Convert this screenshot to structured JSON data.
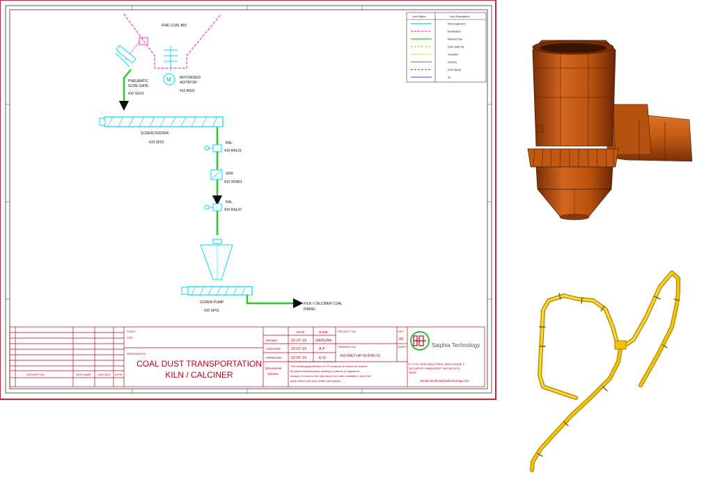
{
  "drawing": {
    "labels": {
      "fine_coal_bin": "FINE COAL BIN",
      "pneumatic_slide_gate": [
        "PNEUMATIC",
        "SLIDE GATE",
        "410 SG01"
      ],
      "motorised_agitator": [
        "MOTORISED",
        "AGITATOR",
        "410 AG01"
      ],
      "screw_feeder": [
        "SCREW FEEDER",
        "410 SF01"
      ],
      "ral_1": [
        "RAL",
        "410 RAL01"
      ],
      "sfm": [
        "SFM",
        "410 SFM01"
      ],
      "ral_2": [
        "RAL",
        "410 RAL02"
      ],
      "screw_pump": [
        "SCREW PUMP",
        "410 SP01"
      ],
      "kiln_firing": [
        "KILN / CALCINER COAL",
        "FIRING"
      ]
    },
    "legend": {
      "header_style": "Line Styles",
      "header_desc": "Line Description",
      "rows": [
        {
          "description": "New Equipment",
          "color": "#00d8ff",
          "dash": "solid"
        },
        {
          "description": "Modification",
          "color": "#ff33cc",
          "dash": "dashed"
        },
        {
          "description": "Material Flow",
          "color": "#22cc22",
          "dash": "solid"
        },
        {
          "description": "Dust Laden Air",
          "color": "#99cc66",
          "dash": "dashed"
        },
        {
          "description": "Insulation",
          "color": "#f0e060",
          "dash": "solid"
        },
        {
          "description": "Existing",
          "color": "#888888",
          "dash": "solid"
        },
        {
          "description": "Duct Taping",
          "color": "#666666",
          "dash": "dashed"
        },
        {
          "description": "Air",
          "color": "#6666ff",
          "dash": "solid"
        }
      ]
    },
    "title_block": {
      "revision_headers": [
        "DESCRIPTION",
        "DATE/NAME",
        "CHECKED",
        "APPR."
      ],
      "plant_label": "PLANT",
      "site_label": "SITE",
      "designation_label": "DESIGNATION",
      "title_line1": "COAL DUST TRANSPORTATION",
      "title_line2": "KILN / CALCINER",
      "date_header": "DATE",
      "name_header": "NAME",
      "drawn_label": "DRAWN",
      "drawn_date": "22-07-19",
      "drawn_name": "SANGAR",
      "checked_label": "CHECKED",
      "checked_date": "22-07-19",
      "checked_name": "A.P",
      "approved_label": "APPROVED",
      "approved_date": "22-07-19",
      "approved_name": "D.G",
      "project_no_label": "PROJECT NO",
      "drawing_no_label": "DRAWING NO",
      "drawing_no": "410-MKT-HP-EFD40-01",
      "rev_label": "REV",
      "rev_value": "00",
      "sheet_label": "SHEET",
      "dimensional_variation": [
        "Dimensional",
        "Variation"
      ],
      "disclaimer": [
        "This drawing/specification is STI property for which we reserve",
        "all rights,including those relating to patents or registered",
        "designs. It must not be reproduced or made available to any third",
        "party without our prior written permission."
      ],
      "company_name": "Saiphia Technology",
      "address": [
        "E 27/29, NEW INDUSTRIAL AREA,PHASE II",
        "DATLAPUR, MANDIDEEP, 462046 (M.P.)",
        "INDIA"
      ],
      "email": "Email info@saiphiatechnology.com"
    }
  },
  "colors": {
    "frame": "#cc2233",
    "border": "#222222",
    "equipment": "#00d8ff",
    "modification": "#ff33cc",
    "material_flow": "#22cc22",
    "title_block": "#b8001a",
    "logo_ring": "#33bb33",
    "cyclone": "#c85a18",
    "pipe": "#f2c400"
  },
  "icons": [
    "motor-icon",
    "company-logo-icon"
  ]
}
